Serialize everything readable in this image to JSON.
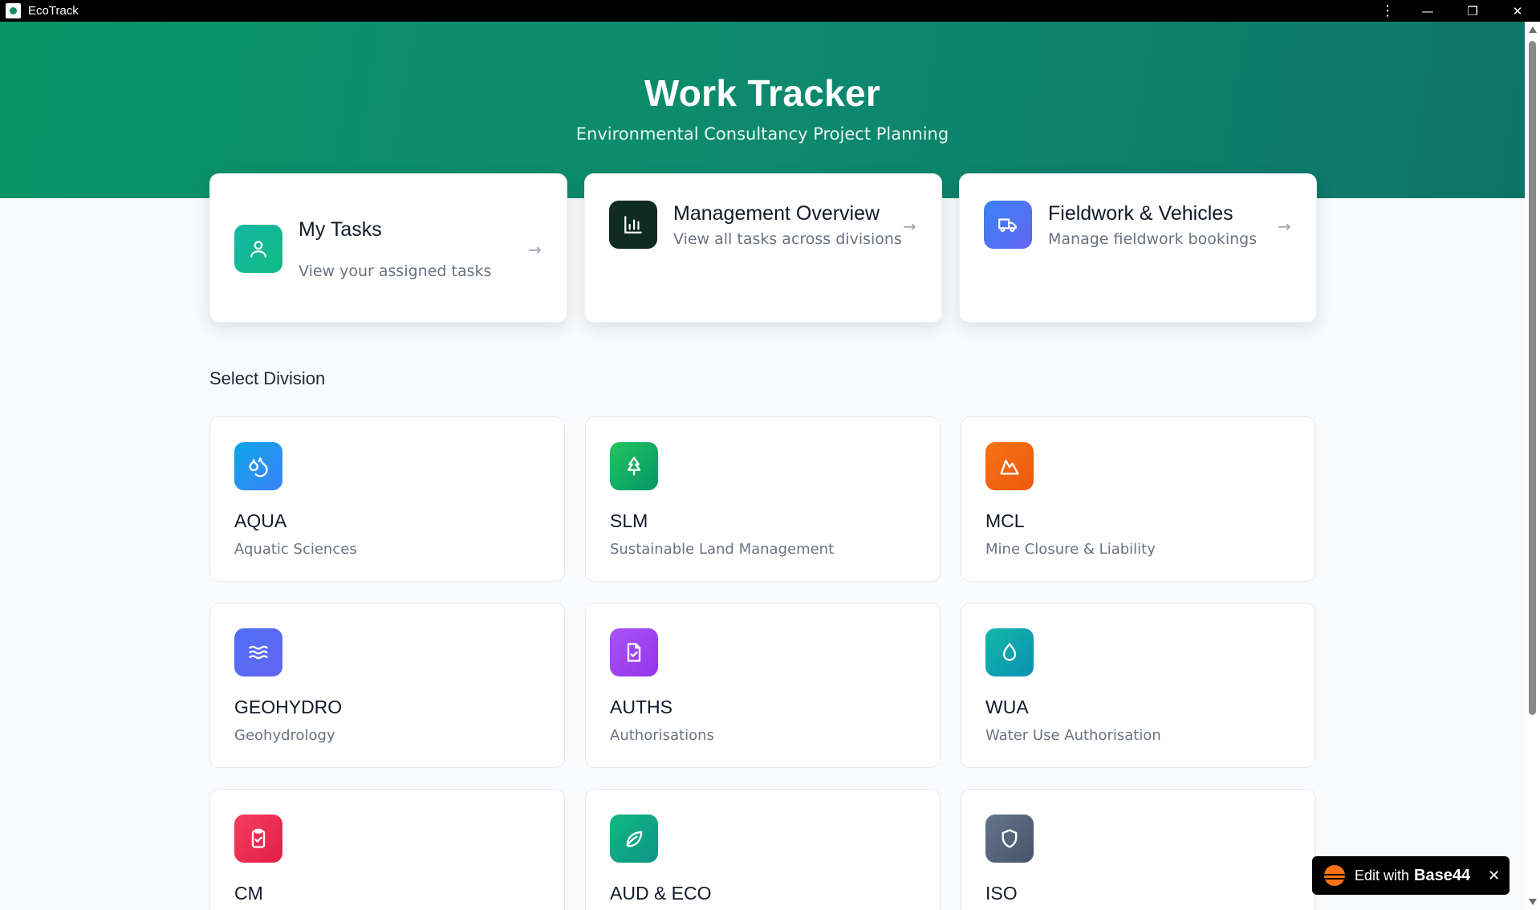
{
  "window": {
    "title": "EcoTrack",
    "menu_icon": "⋮",
    "minimize_icon": "—",
    "maximize_icon": "❐",
    "close_icon": "✕"
  },
  "hero": {
    "title": "Work Tracker",
    "subtitle": "Environmental Consultancy Project Planning",
    "gradient": [
      "#0a9465",
      "#0e7468"
    ]
  },
  "actions": [
    {
      "title": "My Tasks",
      "description": "View your assigned tasks",
      "icon": "user-icon",
      "color": "#10b981",
      "arrow": "→"
    },
    {
      "title": "Management Overview",
      "description": "View all tasks across divisions",
      "icon": "bar-chart-icon",
      "color": "#0f2b22",
      "arrow": "→"
    },
    {
      "title": "Fieldwork & Vehicles",
      "description": "Manage fieldwork bookings",
      "icon": "truck-icon",
      "color": "#4f6ef7",
      "arrow": "→"
    }
  ],
  "section_title": "Select Division",
  "divisions": [
    {
      "code": "AQUA",
      "name": "Aquatic Sciences",
      "icon": "droplets-icon",
      "color": "#0ea5e9"
    },
    {
      "code": "SLM",
      "name": "Sustainable Land Management",
      "icon": "tree-icon",
      "color": "#16a34a"
    },
    {
      "code": "MCL",
      "name": "Mine Closure & Liability",
      "icon": "mountain-icon",
      "color": "#f97316"
    },
    {
      "code": "GEOHYDRO",
      "name": "Geohydrology",
      "icon": "waves-icon",
      "color": "#4f6ef7"
    },
    {
      "code": "AUTHS",
      "name": "Authorisations",
      "icon": "file-check-icon",
      "color": "#a855f7"
    },
    {
      "code": "WUA",
      "name": "Water Use Authorisation",
      "icon": "droplet-icon",
      "color": "#14b8a6"
    },
    {
      "code": "CM",
      "name": "",
      "icon": "clipboard-check-icon",
      "color": "#f43f5e"
    },
    {
      "code": "AUD & ECO",
      "name": "",
      "icon": "leaf-icon",
      "color": "#10b981"
    },
    {
      "code": "ISO",
      "name": "",
      "icon": "shield-icon",
      "color": "#64748b"
    }
  ],
  "badge": {
    "label": "Edit with",
    "brand": "Base44",
    "close": "✕"
  }
}
